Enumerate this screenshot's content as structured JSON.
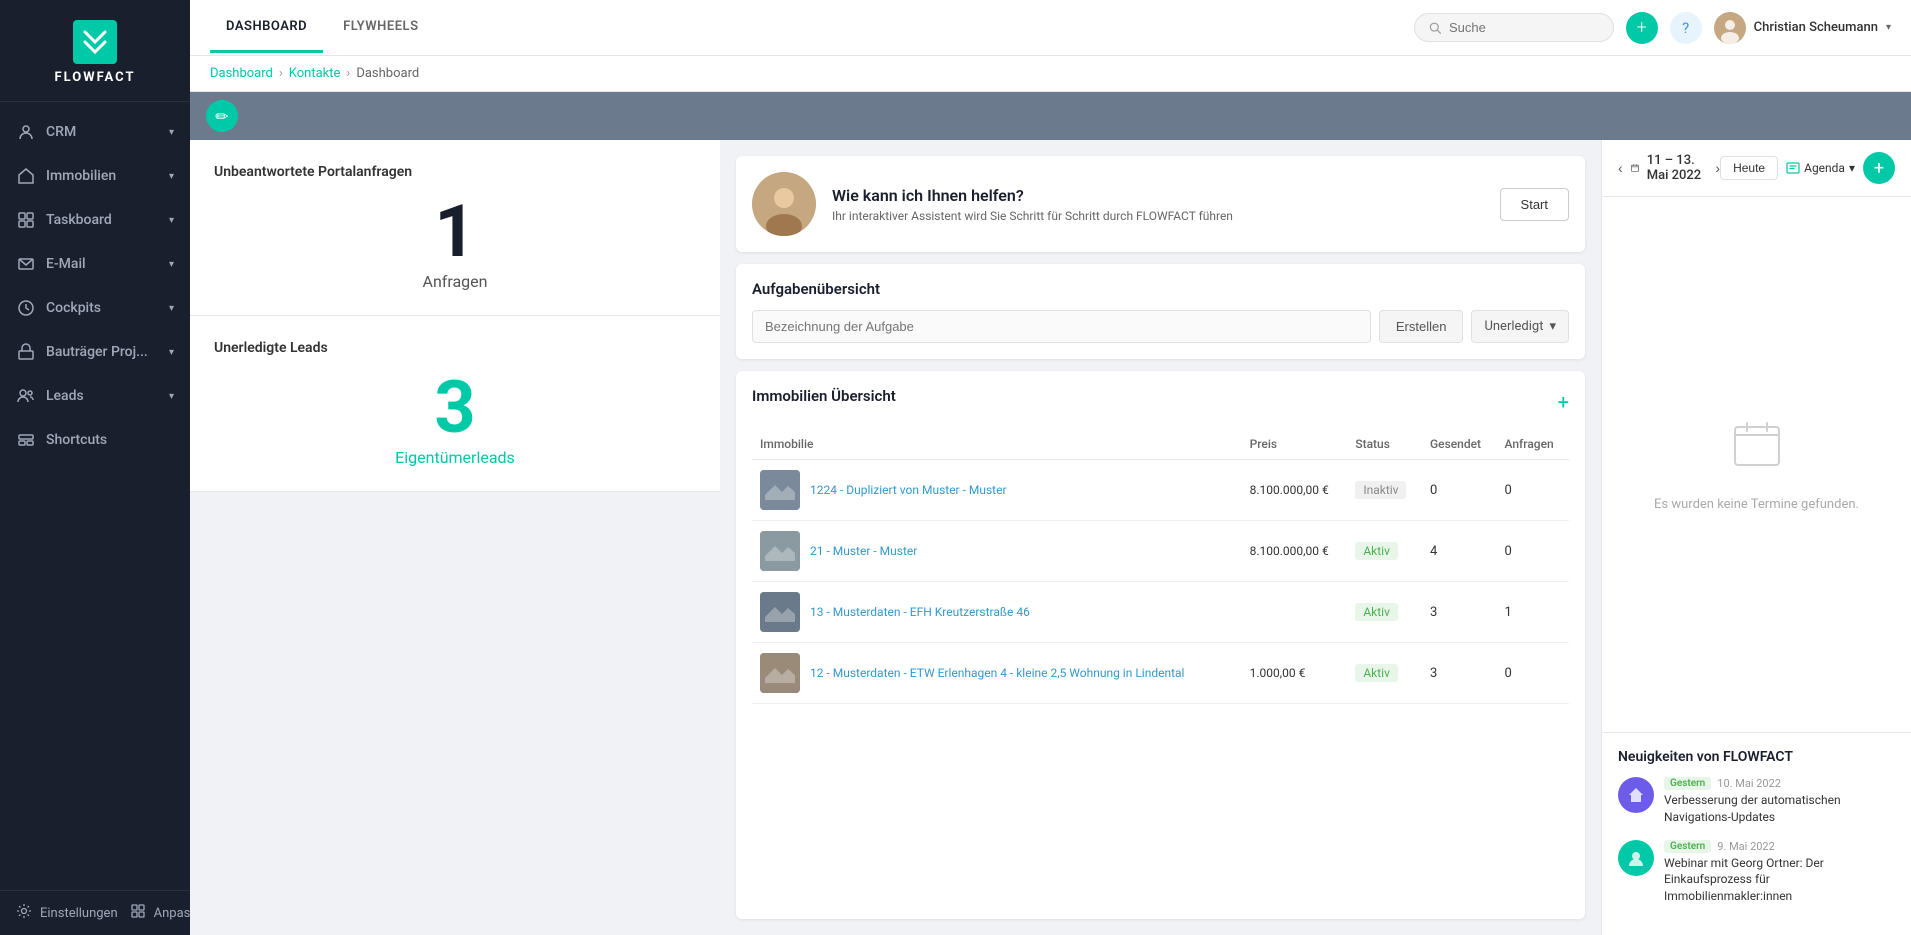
{
  "sidebar": {
    "logo_text": "FLOWFACT",
    "nav_items": [
      {
        "id": "crm",
        "label": "CRM",
        "has_chevron": true
      },
      {
        "id": "immobilien",
        "label": "Immobilien",
        "has_chevron": true
      },
      {
        "id": "taskboard",
        "label": "Taskboard",
        "has_chevron": true
      },
      {
        "id": "email",
        "label": "E-Mail",
        "has_chevron": true
      },
      {
        "id": "cockpits",
        "label": "Cockpits",
        "has_chevron": true
      },
      {
        "id": "bautraeger",
        "label": "Bauträger Proj...",
        "has_chevron": true
      },
      {
        "id": "leads",
        "label": "Leads",
        "has_chevron": true
      },
      {
        "id": "shortcuts",
        "label": "Shortcuts",
        "has_chevron": false
      }
    ],
    "bottom_items": [
      {
        "id": "einstellungen",
        "label": "Einstellungen"
      },
      {
        "id": "anpassen",
        "label": "Anpassen"
      }
    ]
  },
  "header": {
    "tabs": [
      {
        "id": "dashboard",
        "label": "DASHBOARD",
        "active": true
      },
      {
        "id": "flywheels",
        "label": "FLYWHEELS",
        "active": false
      }
    ],
    "search_placeholder": "Suche",
    "user_name": "Christian Scheumann"
  },
  "breadcrumb": {
    "items": [
      "Dashboard",
      "Kontakte",
      "Dashboard"
    ]
  },
  "left_panel": {
    "portalanfragen_title": "Unbeantwortete Portalanfragen",
    "anfragen_count": "1",
    "anfragen_label": "Anfragen",
    "leads_title": "Unerledigte Leads",
    "leads_count": "3",
    "leads_label": "Eigentümerleads"
  },
  "assistant": {
    "title": "Wie kann ich Ihnen helfen?",
    "subtitle": "Ihr interaktiver Assistent wird Sie Schritt für Schritt durch FLOWFACT führen",
    "btn_label": "Start"
  },
  "tasks": {
    "title": "Aufgabenübersicht",
    "input_placeholder": "Bezeichnung der Aufgabe",
    "create_label": "Erstellen",
    "status_label": "Unerledigt"
  },
  "immobilien": {
    "title": "Immobilien Übersicht",
    "columns": [
      "Immobilie",
      "Preis",
      "Status",
      "Gesendet",
      "Anfragen"
    ],
    "rows": [
      {
        "id": "1224",
        "name": "1224 - Dupliziert von Muster - Muster",
        "price": "8.100.000,00 €",
        "status": "Inaktiv",
        "gesendet": "0",
        "anfragen": "0"
      },
      {
        "id": "21",
        "name": "21 - Muster - Muster",
        "price": "8.100.000,00 €",
        "status": "Aktiv",
        "gesendet": "4",
        "anfragen": "0"
      },
      {
        "id": "13",
        "name": "13 - Musterdaten - EFH Kreutzerstraße 46",
        "price": "",
        "status": "Aktiv",
        "gesendet": "3",
        "anfragen": "1"
      },
      {
        "id": "12",
        "name": "12 - Musterdaten - ETW Erlenhagen 4 - kleine 2,5 Wohnung in Lindental",
        "price": "1.000,00 €",
        "status": "Aktiv",
        "gesendet": "3",
        "anfragen": "0"
      }
    ]
  },
  "calendar": {
    "range": "11 – 13. Mai 2022",
    "today_label": "Heute",
    "agenda_label": "Agenda",
    "empty_text": "Es wurden keine Termine gefunden.",
    "add_btn": "+"
  },
  "news": {
    "title": "Neuigkeiten von FLOWFACT",
    "items": [
      {
        "id": "news1",
        "badge": "Gestern",
        "date": "10. Mai 2022",
        "text": "Verbesserung der automatischen Navigations-Updates",
        "avatar_type": "purple"
      },
      {
        "id": "news2",
        "badge": "Gestern",
        "date": "9. Mai 2022",
        "text": "Webinar mit Georg Ortner: Der Einkaufsprozess für Immobilienmakler:innen",
        "avatar_type": "teal"
      }
    ]
  }
}
